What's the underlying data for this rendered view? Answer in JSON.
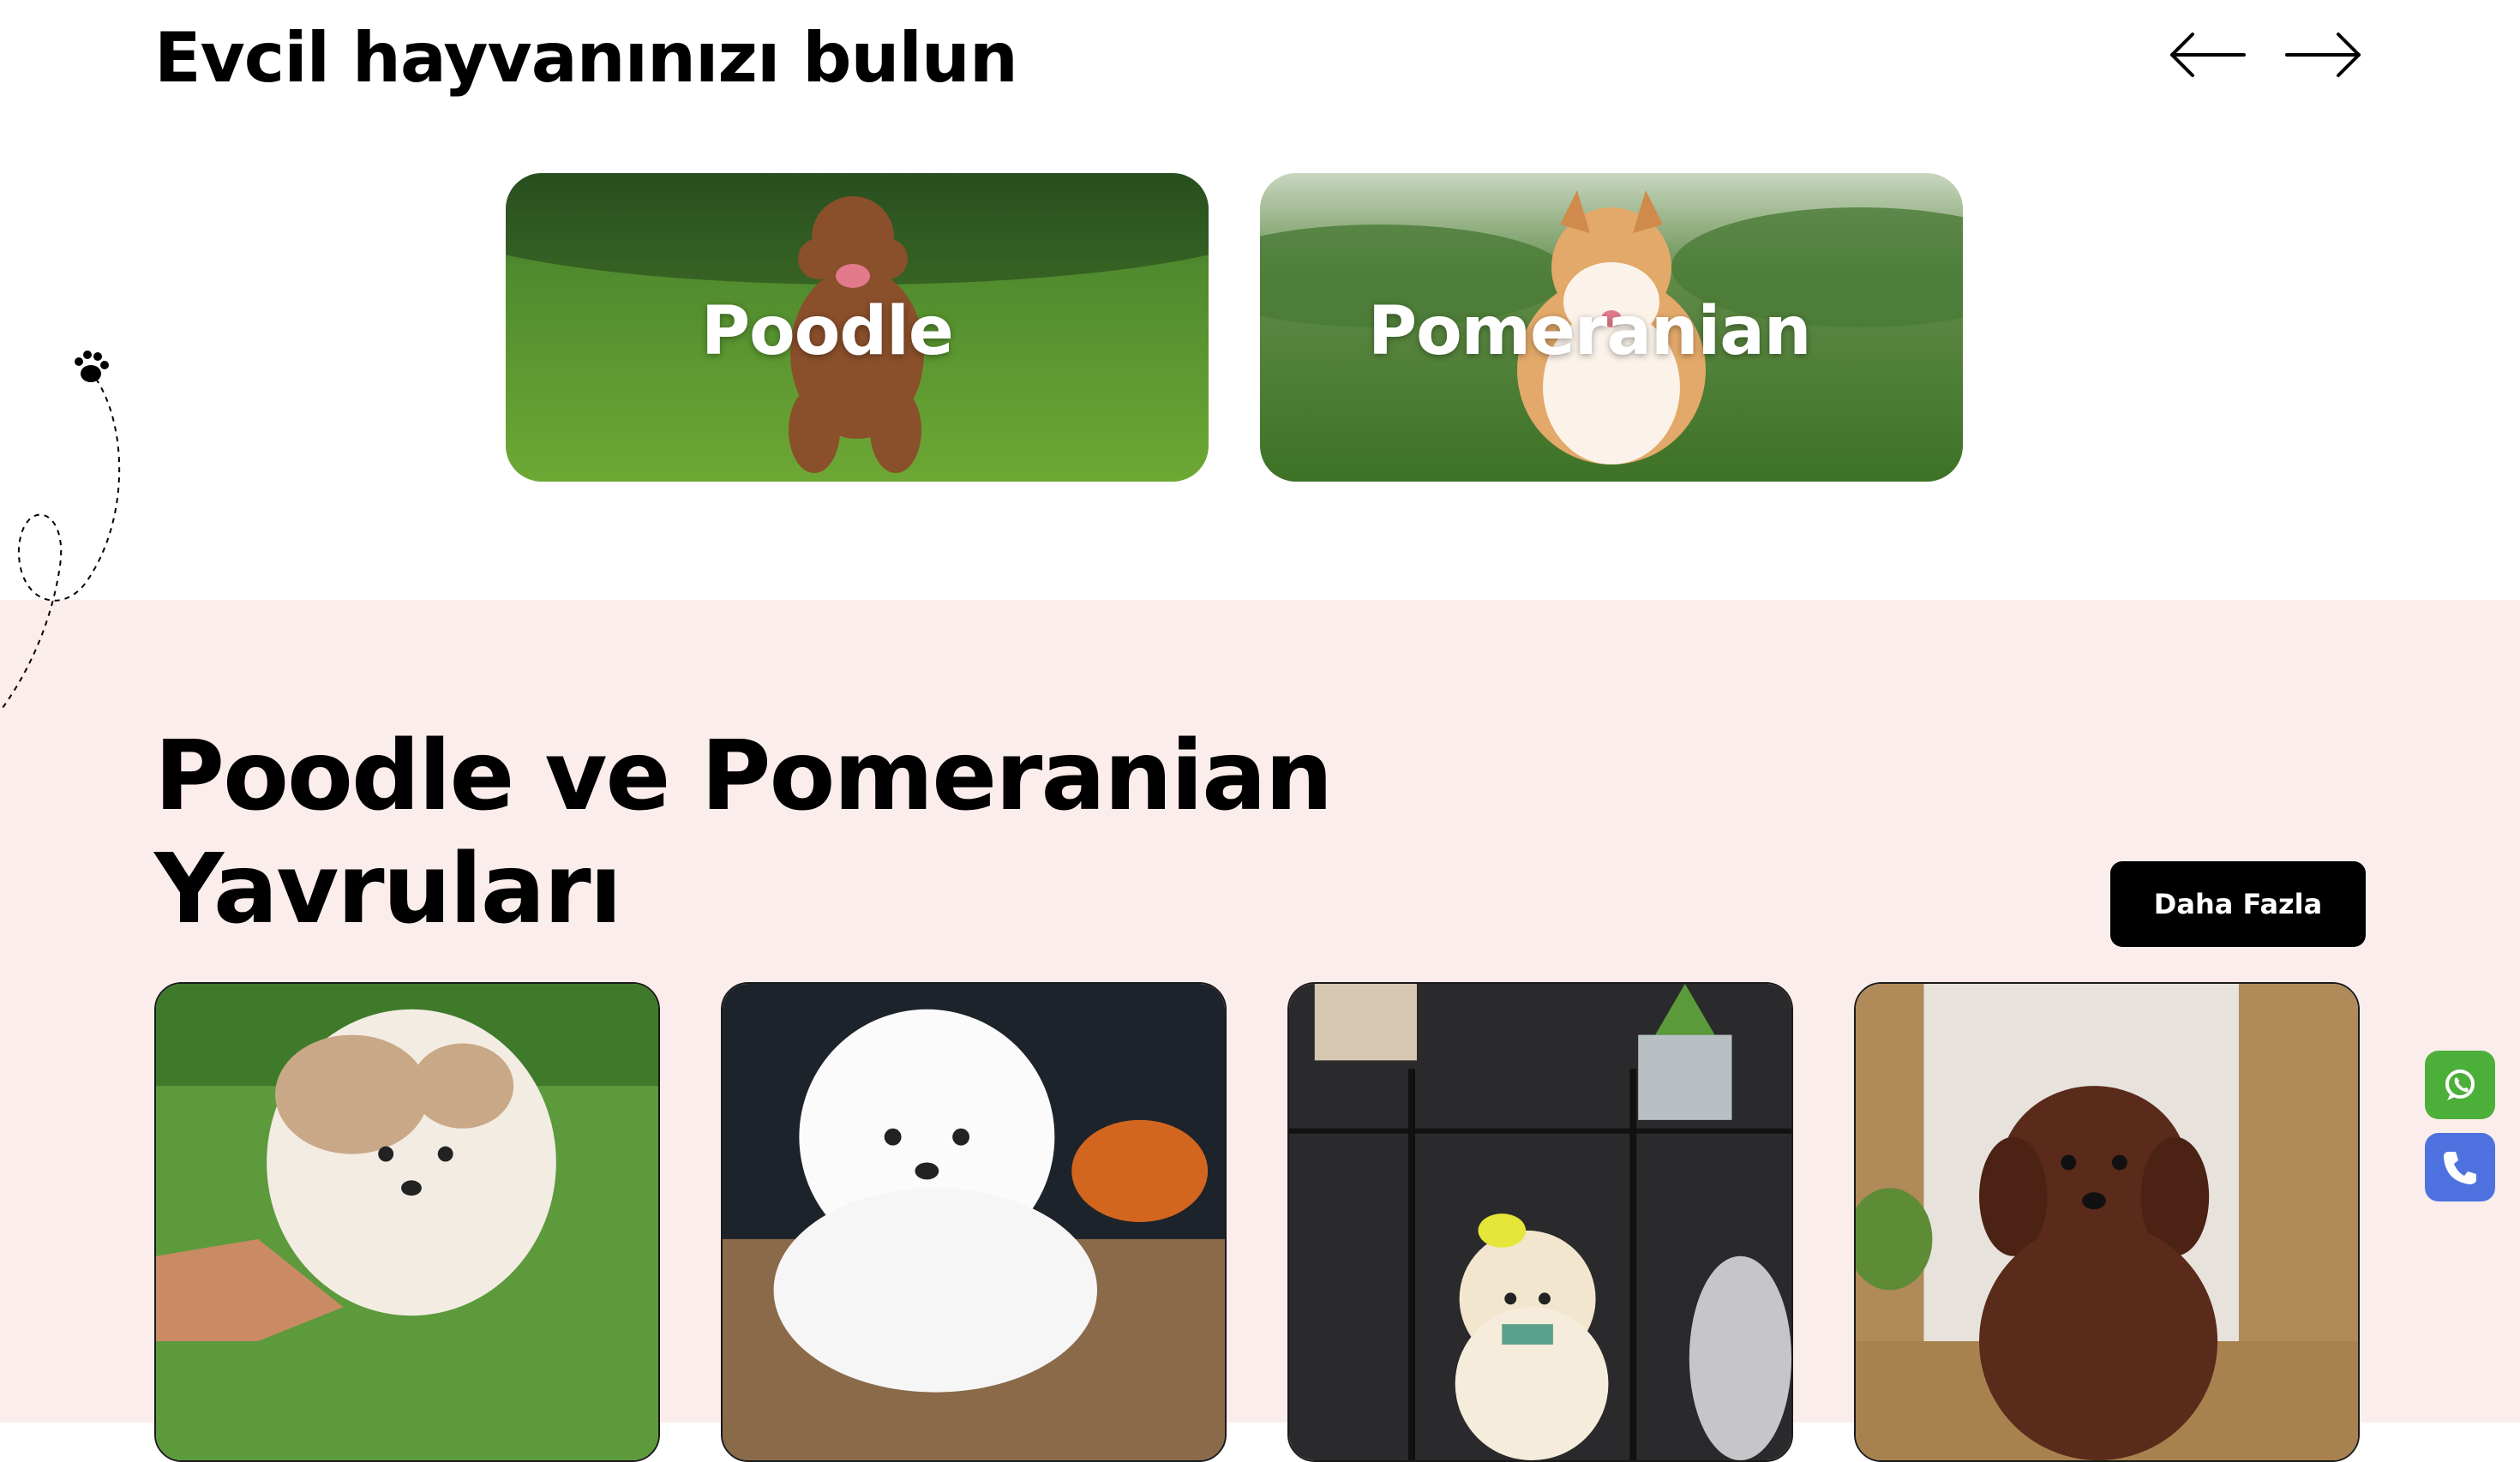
{
  "categories_section": {
    "title": "Evcil hayvanınızı bulun",
    "cards": [
      {
        "label": "Poodle"
      },
      {
        "label": "Pomeranian"
      }
    ]
  },
  "puppies_section": {
    "headline_line1": "Poodle ve Pomeranian",
    "headline_line2": "Yavruları",
    "more_button": "Daha Fazla"
  },
  "icons": {
    "prev": "arrow-left-icon",
    "next": "arrow-right-icon",
    "decoration": "paw-icon",
    "whatsapp": "whatsapp-icon",
    "phone": "phone-icon"
  },
  "colors": {
    "section_background": "#fbedeb",
    "button_background": "#000000",
    "whatsapp_green": "#4caf3a",
    "phone_blue": "#4d72e0"
  }
}
